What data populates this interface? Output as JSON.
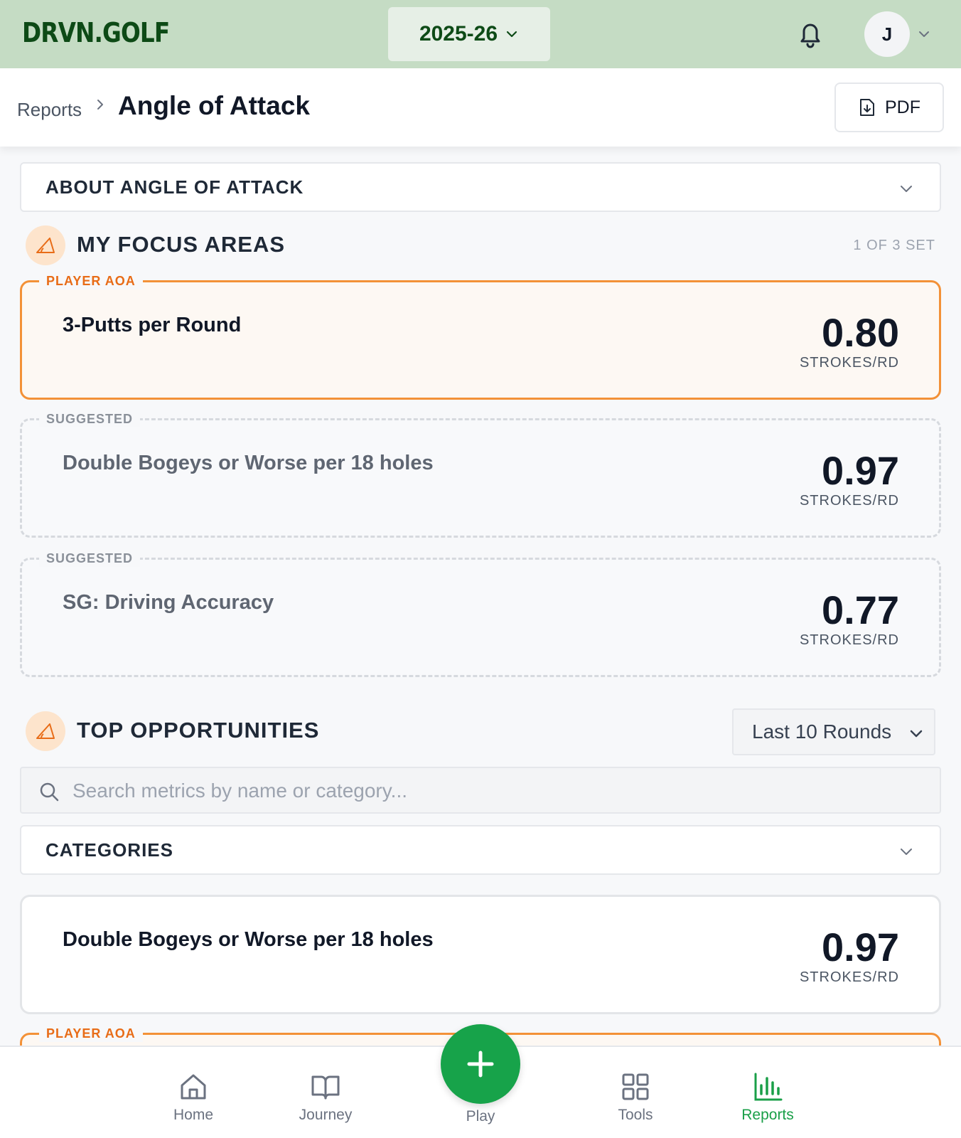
{
  "header": {
    "logo": "DRVN.GOLF",
    "season": "2025-26",
    "avatar_initial": "J"
  },
  "subheader": {
    "breadcrumb": "Reports",
    "title": "Angle of Attack",
    "pdf_label": "PDF"
  },
  "about": {
    "label": "ABOUT ANGLE OF ATTACK"
  },
  "focus": {
    "title": "MY FOCUS AREAS",
    "meta": "1 OF 3 SET",
    "cards": [
      {
        "tag": "PLAYER AOA",
        "name": "3-Putts per Round",
        "value": "0.80",
        "unit": "STROKES/RD"
      },
      {
        "tag": "SUGGESTED",
        "name": "Double Bogeys or Worse per 18 holes",
        "value": "0.97",
        "unit": "STROKES/RD"
      },
      {
        "tag": "SUGGESTED",
        "name": "SG: Driving Accuracy",
        "value": "0.77",
        "unit": "STROKES/RD"
      }
    ]
  },
  "opportunities": {
    "title": "TOP OPPORTUNITIES",
    "range_selected": "Last 10 Rounds",
    "search_placeholder": "Search metrics by name or category...",
    "categories_label": "CATEGORIES",
    "cards": [
      {
        "name": "Double Bogeys or Worse per 18 holes",
        "value": "0.97",
        "unit": "STROKES/RD"
      },
      {
        "tag": "PLAYER AOA"
      }
    ]
  },
  "nav": {
    "items": [
      {
        "label": "Home",
        "icon": "home-icon"
      },
      {
        "label": "Journey",
        "icon": "book-icon"
      },
      {
        "label": "Play",
        "icon": "plus-icon"
      },
      {
        "label": "Tools",
        "icon": "grid-icon"
      },
      {
        "label": "Reports",
        "icon": "bar-chart-icon"
      }
    ]
  },
  "colors": {
    "header_bg": "#c5dcc4",
    "brand_green": "#0d4a16",
    "accent_orange": "#f39137",
    "active_green": "#1a9f48"
  }
}
